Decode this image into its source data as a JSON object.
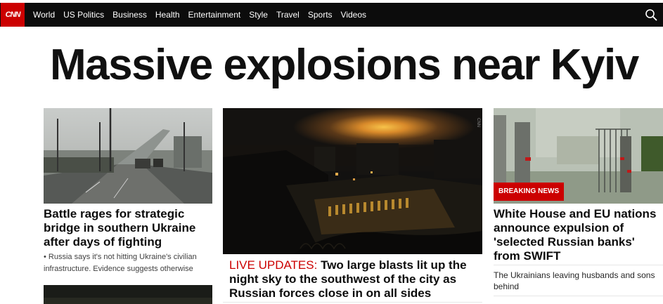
{
  "nav": {
    "logo": "CNN",
    "items": [
      "World",
      "US Politics",
      "Business",
      "Health",
      "Entertainment",
      "Style",
      "Travel",
      "Sports",
      "Videos"
    ],
    "search_icon": "search-icon"
  },
  "headline": "Massive explosions near Kyiv",
  "left_story": {
    "title": "Battle rages for strategic bridge in southern Ukraine after days of fighting",
    "sub": "• Russia says it's not hitting Ukraine's civilian infrastructure. Evidence suggests otherwise"
  },
  "center_story": {
    "live_label": "LIVE UPDATES:",
    "title": " Two large blasts lit up the night sky to the southwest of the city as Russian forces close in on all sides"
  },
  "right_story": {
    "badge": "BREAKING NEWS",
    "title": "White House and EU nations announce expulsion of 'selected Russian banks' from SWIFT",
    "sub": "The Ukrainians leaving husbands and sons behind"
  },
  "colors": {
    "brand": "#cc0000",
    "nav_bg": "#0c0c0c"
  }
}
